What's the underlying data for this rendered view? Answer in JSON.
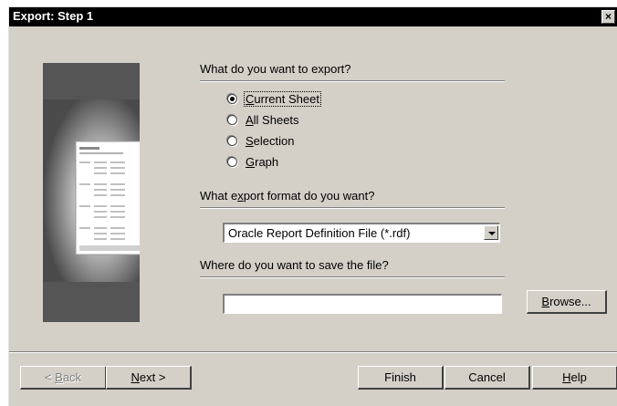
{
  "window": {
    "title": "Export: Step 1",
    "close_symbol": "×"
  },
  "sections": {
    "what_label": "What do you want to export?",
    "format_label_pre": "What e",
    "format_label_key": "x",
    "format_label_post": "port format do you want?",
    "save_label": "Where do you want to save the file?"
  },
  "export_options": [
    {
      "key": "C",
      "rest": "urrent Sheet",
      "checked": true
    },
    {
      "key": "A",
      "rest": "ll Sheets",
      "checked": false
    },
    {
      "key": "S",
      "rest": "election",
      "checked": false
    },
    {
      "key": "G",
      "rest": "raph",
      "checked": false
    }
  ],
  "format": {
    "selected": "Oracle Report Definition File (*.rdf)"
  },
  "save_path": {
    "value": ""
  },
  "buttons": {
    "browse": {
      "key": "B",
      "rest": "rowse..."
    },
    "back": {
      "pre": "< ",
      "key": "B",
      "rest": "ack"
    },
    "next": {
      "key": "N",
      "rest": "ext >"
    },
    "finish": "Finish",
    "cancel": "Cancel",
    "help": {
      "key": "H",
      "rest": "elp"
    }
  },
  "colors": {
    "dialog_bg": "#d4d0c8",
    "titlebar_bg": "#000000",
    "art_band": "#555555"
  }
}
